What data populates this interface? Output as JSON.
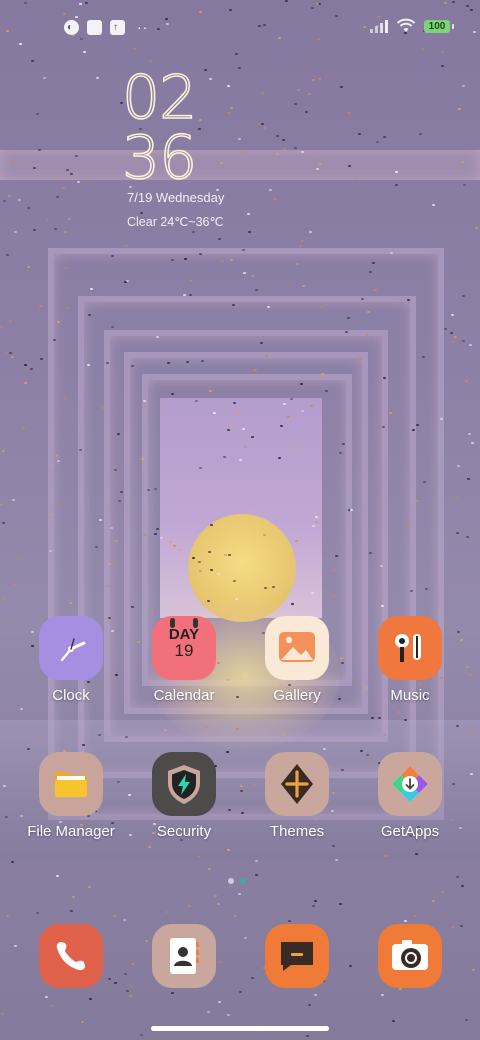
{
  "status_bar": {
    "notif_icons": [
      "app-notification-icon",
      "square-notification-icon",
      "upload-icon"
    ],
    "more": "··",
    "battery": "100"
  },
  "clock_widget": {
    "hours": "02",
    "minutes": "36",
    "date": "7/19 Wednesday",
    "weather": "Clear 24℃~36℃"
  },
  "apps": {
    "row1": [
      {
        "label": "Clock",
        "icon": "clock-icon",
        "color": "#a68ee0"
      },
      {
        "label": "Calendar",
        "icon": "calendar-icon",
        "color": "#f2707a",
        "day_text": "DAY",
        "day_num": "19"
      },
      {
        "label": "Gallery",
        "icon": "gallery-icon",
        "color": "#fbe9d8"
      },
      {
        "label": "Music",
        "icon": "music-icon",
        "color": "#f0783f"
      }
    ],
    "row2": [
      {
        "label": "File Manager",
        "icon": "folder-icon",
        "color": "#c8a49a"
      },
      {
        "label": "Security",
        "icon": "shield-icon",
        "color": "#4d4a4a"
      },
      {
        "label": "Themes",
        "icon": "themes-icon",
        "color": "#c9a79d"
      },
      {
        "label": "GetApps",
        "icon": "getapps-icon",
        "color": "#c9a79d"
      }
    ]
  },
  "dock": [
    {
      "name": "phone",
      "icon": "phone-icon",
      "color": "#e0614a"
    },
    {
      "name": "contacts",
      "icon": "contacts-icon",
      "color": "#c9a79d"
    },
    {
      "name": "messages",
      "icon": "messages-icon",
      "color": "#f07a38"
    },
    {
      "name": "camera",
      "icon": "camera-icon",
      "color": "#f07a38"
    }
  ],
  "page_indicator": {
    "count": 2,
    "active": 1
  }
}
